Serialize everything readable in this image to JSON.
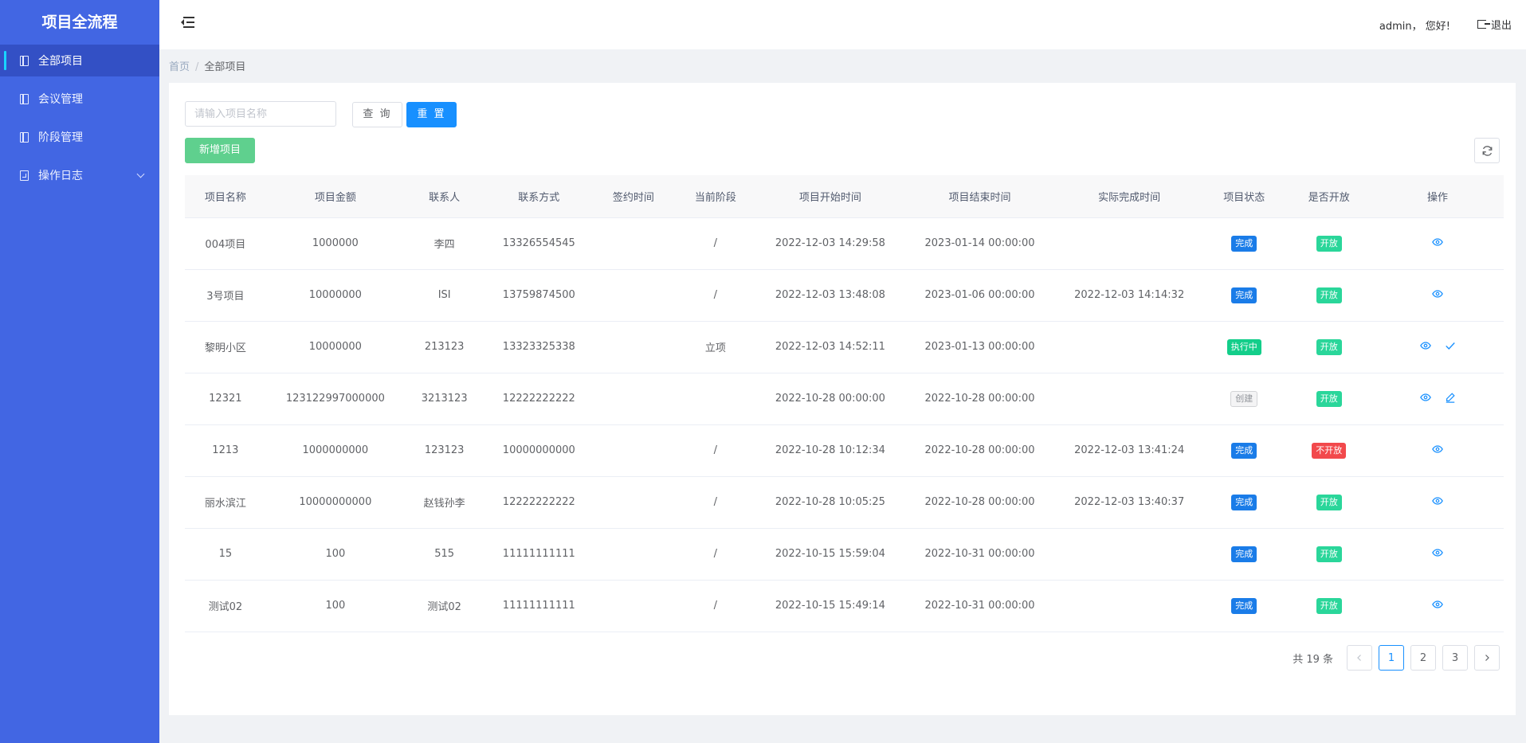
{
  "app": {
    "title": "项目全流程"
  },
  "sidebar": {
    "items": [
      {
        "label": "全部项目",
        "icon": "document-icon",
        "active": true
      },
      {
        "label": "会议管理",
        "icon": "document-icon"
      },
      {
        "label": "阶段管理",
        "icon": "document-icon"
      },
      {
        "label": "操作日志",
        "icon": "log-icon",
        "has_submenu": true
      }
    ]
  },
  "header": {
    "user_greeting": "admin， 您好!",
    "logout_label": "退出"
  },
  "breadcrumb": {
    "home": "首页",
    "separator": "/",
    "current": "全部项目"
  },
  "search": {
    "placeholder": "请输入项目名称",
    "value": "",
    "query_label": "查 询",
    "reset_label": "重 置",
    "add_label": "新增项目"
  },
  "table": {
    "columns": [
      "项目名称",
      "项目金额",
      "联系人",
      "联系方式",
      "签约时间",
      "当前阶段",
      "项目开始时间",
      "项目结束时间",
      "实际完成时间",
      "项目状态",
      "是否开放",
      "操作"
    ],
    "rows": [
      {
        "name": "004项目",
        "amount": "1000000",
        "contact": "李四",
        "phone": "13326554545",
        "sign_time": "",
        "stage": "/",
        "start": "2022-12-03 14:29:58",
        "end": "2023-01-14 00:00:00",
        "finish": "",
        "status": "完成",
        "status_type": "done",
        "open": "开放",
        "open_type": "open",
        "actions": [
          "view"
        ]
      },
      {
        "name": "3号项目",
        "amount": "10000000",
        "contact": "ISI",
        "phone": "13759874500",
        "sign_time": "",
        "stage": "/",
        "start": "2022-12-03 13:48:08",
        "end": "2023-01-06 00:00:00",
        "finish": "2022-12-03 14:14:32",
        "status": "完成",
        "status_type": "done",
        "open": "开放",
        "open_type": "open",
        "actions": [
          "view"
        ]
      },
      {
        "name": "黎明小区",
        "amount": "10000000",
        "contact": "213123",
        "phone": "13323325338",
        "sign_time": "",
        "stage": "立项",
        "start": "2022-12-03 14:52:11",
        "end": "2023-01-13 00:00:00",
        "finish": "",
        "status": "执行中",
        "status_type": "exec",
        "open": "开放",
        "open_type": "open",
        "actions": [
          "view",
          "check"
        ]
      },
      {
        "name": "12321",
        "amount": "123122997000000",
        "contact": "3213123",
        "phone": "12222222222",
        "sign_time": "",
        "stage": "",
        "start": "2022-10-28 00:00:00",
        "end": "2022-10-28 00:00:00",
        "finish": "",
        "status": "创建",
        "status_type": "create",
        "open": "开放",
        "open_type": "open",
        "actions": [
          "view",
          "edit"
        ]
      },
      {
        "name": "1213",
        "amount": "1000000000",
        "contact": "123123",
        "phone": "10000000000",
        "sign_time": "",
        "stage": "/",
        "start": "2022-10-28 10:12:34",
        "end": "2022-10-28 00:00:00",
        "finish": "2022-12-03 13:41:24",
        "status": "完成",
        "status_type": "done",
        "open": "不开放",
        "open_type": "closed",
        "actions": [
          "view"
        ]
      },
      {
        "name": "丽水滨江",
        "amount": "10000000000",
        "contact": "赵钱孙李",
        "phone": "12222222222",
        "sign_time": "",
        "stage": "/",
        "start": "2022-10-28 10:05:25",
        "end": "2022-10-28 00:00:00",
        "finish": "2022-12-03 13:40:37",
        "status": "完成",
        "status_type": "done",
        "open": "开放",
        "open_type": "open",
        "actions": [
          "view"
        ]
      },
      {
        "name": "15",
        "amount": "100",
        "contact": "515",
        "phone": "11111111111",
        "sign_time": "",
        "stage": "/",
        "start": "2022-10-15 15:59:04",
        "end": "2022-10-31 00:00:00",
        "finish": "",
        "status": "完成",
        "status_type": "done",
        "open": "开放",
        "open_type": "open",
        "actions": [
          "view"
        ]
      },
      {
        "name": "测试02",
        "amount": "100",
        "contact": "测试02",
        "phone": "11111111111",
        "sign_time": "",
        "stage": "/",
        "start": "2022-10-15 15:49:14",
        "end": "2022-10-31 00:00:00",
        "finish": "",
        "status": "完成",
        "status_type": "done",
        "open": "开放",
        "open_type": "open",
        "actions": [
          "view"
        ]
      }
    ]
  },
  "pagination": {
    "total_text": "共 19 条",
    "pages": [
      "1",
      "2",
      "3"
    ],
    "current": "1"
  },
  "colors": {
    "sidebar_bg": "#4266e3",
    "primary": "#1890ff",
    "success": "#5fd08e",
    "tag_done": "#1a7ce8",
    "tag_open": "#2ad69a",
    "tag_closed": "#f2494c"
  }
}
